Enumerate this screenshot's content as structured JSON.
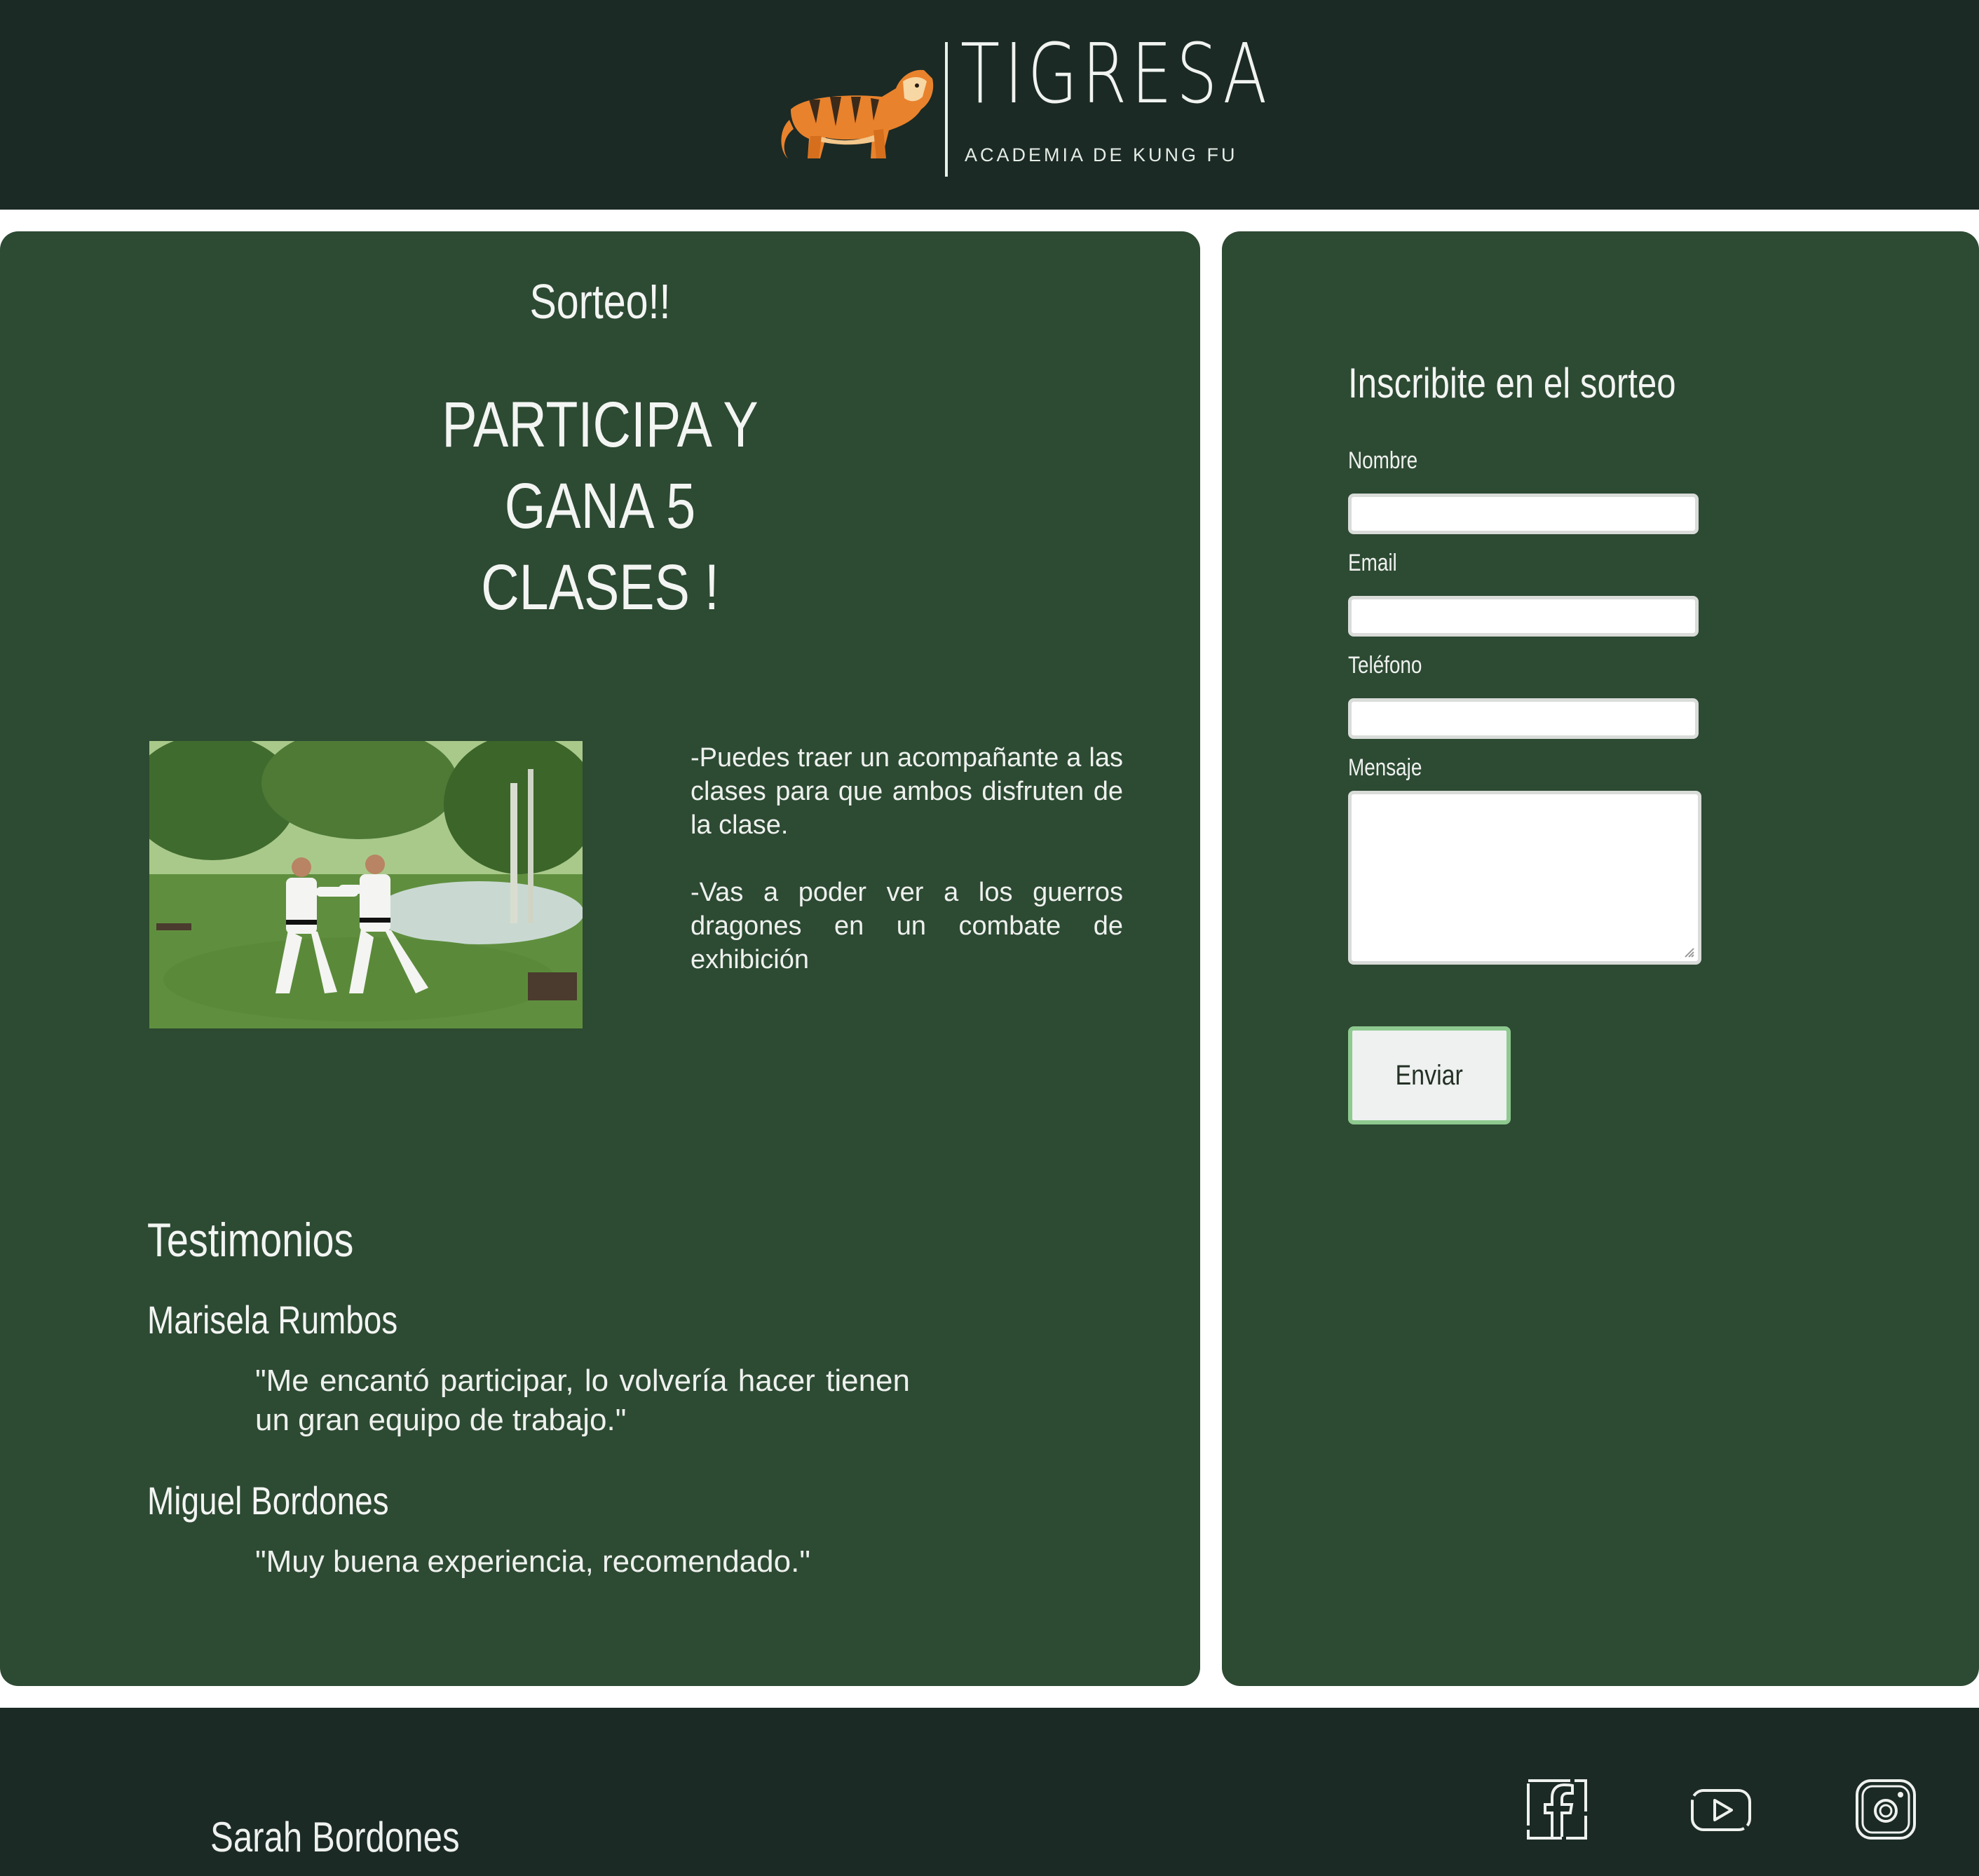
{
  "header": {
    "logo_title": "TIGRESA",
    "logo_subtitle": "ACADEMIA DE KUNG FU",
    "logo_icon": "tiger-icon"
  },
  "promo": {
    "title": "Sorteo!!",
    "headline_line1": "PARTICIPA Y GANA 5",
    "headline_line2": "CLASES !",
    "bullet_1": "-Puedes traer un acompañante a las clases para que ambos disfruten de la clase.",
    "bullet_2": "-Vas a poder ver a los guerros dragones en un combate de exhibición"
  },
  "testimonials": {
    "title": "Testimonios",
    "items": [
      {
        "name": "Marisela Rumbos",
        "quote": "\"Me encantó participar, lo volvería hacer tienen un gran equipo de trabajo.\""
      },
      {
        "name": "Miguel Bordones",
        "quote": "\"Muy buena experiencia, recomendado.\""
      }
    ]
  },
  "form": {
    "title": "Inscribite en el sorteo",
    "name_label": "Nombre",
    "email_label": "Email",
    "phone_label": "Teléfono",
    "message_label": "Mensaje",
    "name_value": "",
    "email_value": "",
    "phone_value": "",
    "message_value": "",
    "submit_label": "Enviar"
  },
  "footer": {
    "author": "Sarah Bordones",
    "social": [
      "facebook-icon",
      "youtube-icon",
      "instagram-icon"
    ]
  },
  "colors": {
    "header_bg": "#1b2a25",
    "panel_bg": "#2d4a33",
    "button_border": "#8ec98f",
    "tiger_orange": "#e9822c"
  }
}
